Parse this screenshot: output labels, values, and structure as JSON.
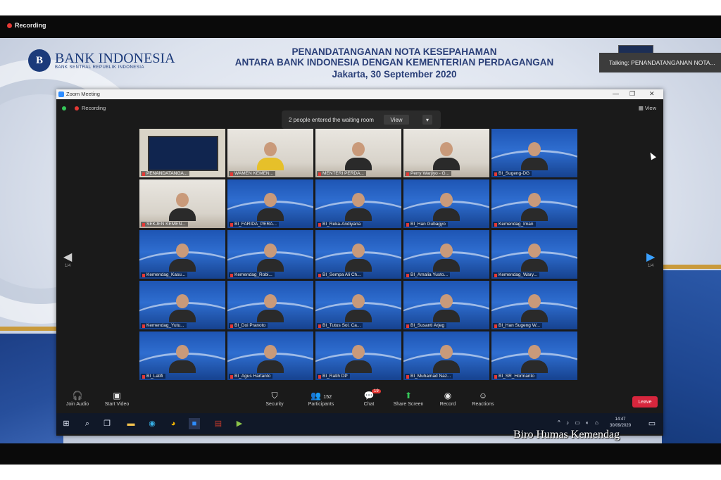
{
  "recording_label": "Recording",
  "slide": {
    "logo_name": "BANK INDONESIA",
    "logo_sub": "BANK SENTRAL REPUBLIK INDONESIA",
    "logo_letter": "B",
    "headline_1": "PENANDATANGANAN NOTA KESEPAHAMAN",
    "headline_2": "ANTARA BANK INDONESIA DENGAN KEMENTERIAN PERDAGANGAN",
    "headline_3": "Jakarta, 30 September 2020",
    "talking": "Talking: PENANDATANGANAN NOTA..."
  },
  "zoom": {
    "window_title": "Zoom Meeting",
    "inner_recording": "Recording",
    "view_label": "View",
    "waiting_text": "2 people entered the waiting room",
    "waiting_view": "View",
    "page_left": "1/4",
    "page_right": "1/4",
    "tiles": [
      {
        "label": "PENANDATANGA...",
        "kind": "active"
      },
      {
        "label": "WAMEN KEMEN...",
        "kind": "room"
      },
      {
        "label": "MENTERI PERDA...",
        "kind": "room"
      },
      {
        "label": "Perry Warjiyo - G...",
        "kind": "room"
      },
      {
        "label": "BI_Sugeng-DG",
        "kind": "blue"
      },
      {
        "label": "SEKJEN KEMEN...",
        "kind": "room"
      },
      {
        "label": "BI_FARIDA_PERA...",
        "kind": "blue"
      },
      {
        "label": "BI_Reka-Andiyana",
        "kind": "blue"
      },
      {
        "label": "BI_Han Gubagyo",
        "kind": "blue"
      },
      {
        "label": "Kemendag_Iman",
        "kind": "blue"
      },
      {
        "label": "Kemendag_Kasu...",
        "kind": "blue"
      },
      {
        "label": "Kemendag_Robi...",
        "kind": "blue"
      },
      {
        "label": "BI_Sempa Ali Ch...",
        "kind": "blue"
      },
      {
        "label": "BI_Amalia Yusto...",
        "kind": "blue"
      },
      {
        "label": "Kemendag_Wary...",
        "kind": "blue"
      },
      {
        "label": "Kemendag_Yutu...",
        "kind": "blue"
      },
      {
        "label": "BI_Doi Pranoto",
        "kind": "blue"
      },
      {
        "label": "BI_Tutus Sol. Ca...",
        "kind": "blue"
      },
      {
        "label": "BI_Susanti Arjeg",
        "kind": "blue"
      },
      {
        "label": "BI_Han Sugeng W...",
        "kind": "blue"
      },
      {
        "label": "BI_Latifi",
        "kind": "blue"
      },
      {
        "label": "BI_Agus Hartanto",
        "kind": "blue"
      },
      {
        "label": "BI_Ratih DP",
        "kind": "blue"
      },
      {
        "label": "BI_Muhamad Naz...",
        "kind": "blue"
      },
      {
        "label": "BI_SR_Hormanto",
        "kind": "blue"
      }
    ],
    "toolbar": {
      "join_audio": "Join Audio",
      "start_video": "Start Video",
      "security": "Security",
      "participants": "Participants",
      "participants_count": "152",
      "chat": "Chat",
      "chat_badge": "19",
      "share_screen": "Share Screen",
      "record": "Record",
      "reactions": "Reactions",
      "leave": "Leave"
    },
    "clock_time": "14:47",
    "clock_date": "30/09/2020"
  },
  "watermark": "Biro Humas Kemendag"
}
